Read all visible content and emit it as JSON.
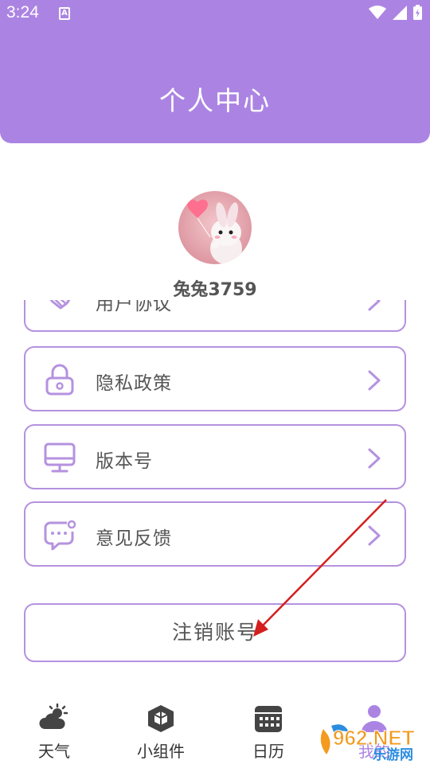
{
  "status_bar": {
    "time": "3:24",
    "notif_icon": "A"
  },
  "header": {
    "title": "个人中心"
  },
  "profile": {
    "username": "兔兔3759"
  },
  "menu": [
    {
      "label": "用户协议",
      "icon": "handshake-icon"
    },
    {
      "label": "隐私政策",
      "icon": "lock-icon"
    },
    {
      "label": "版本号",
      "icon": "monitor-icon"
    },
    {
      "label": "意见反馈",
      "icon": "chat-bubble-icon"
    }
  ],
  "logout": {
    "label": "注销账号"
  },
  "tabs": [
    {
      "label": "天气",
      "icon": "weather-icon"
    },
    {
      "label": "小组件",
      "icon": "cube-icon"
    },
    {
      "label": "日历",
      "icon": "calendar-icon"
    },
    {
      "label": "我的",
      "icon": "profile-icon"
    }
  ],
  "watermark": {
    "text_top": "962.NET",
    "text_bottom": "乐游网"
  },
  "colors": {
    "accent": "#ab84e3",
    "border": "#b592df",
    "arrow": "#d41f1f"
  }
}
